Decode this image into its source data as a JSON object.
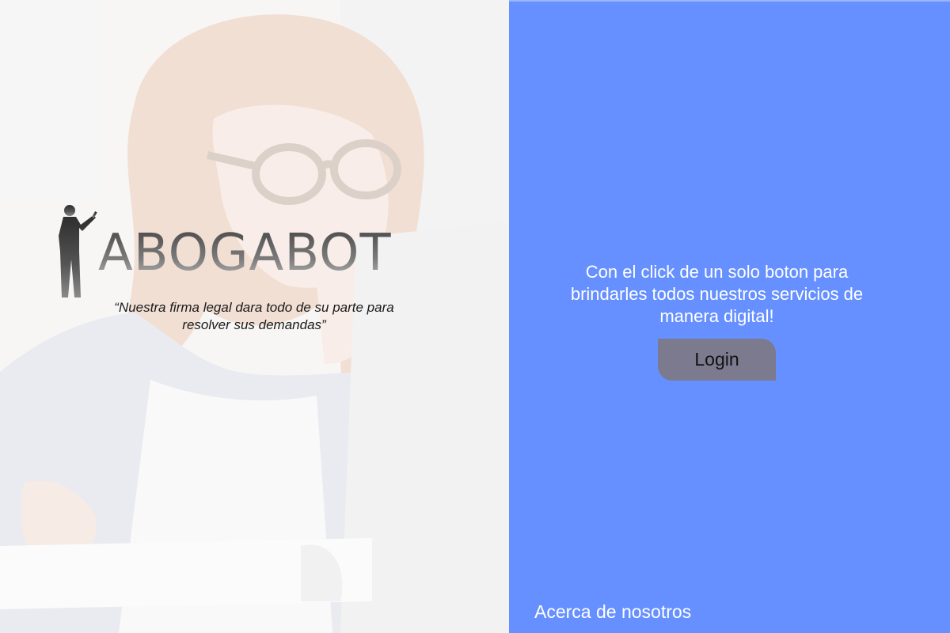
{
  "brand": {
    "name": "ABOGABOT",
    "slogan": "“Nuestra firma legal dara todo de su parte para resolver sus demandas”",
    "logo_icon": "presenter-silhouette-icon"
  },
  "panel": {
    "message": "Con el click de un solo boton para brindarles todos nuestros servicios de manera digital!",
    "login_label": "Login",
    "about_label": "Acerca de nosotros"
  },
  "colors": {
    "panel_background": "#6690ff",
    "login_button": "#7b7a8e",
    "panel_text": "#ffffff"
  }
}
